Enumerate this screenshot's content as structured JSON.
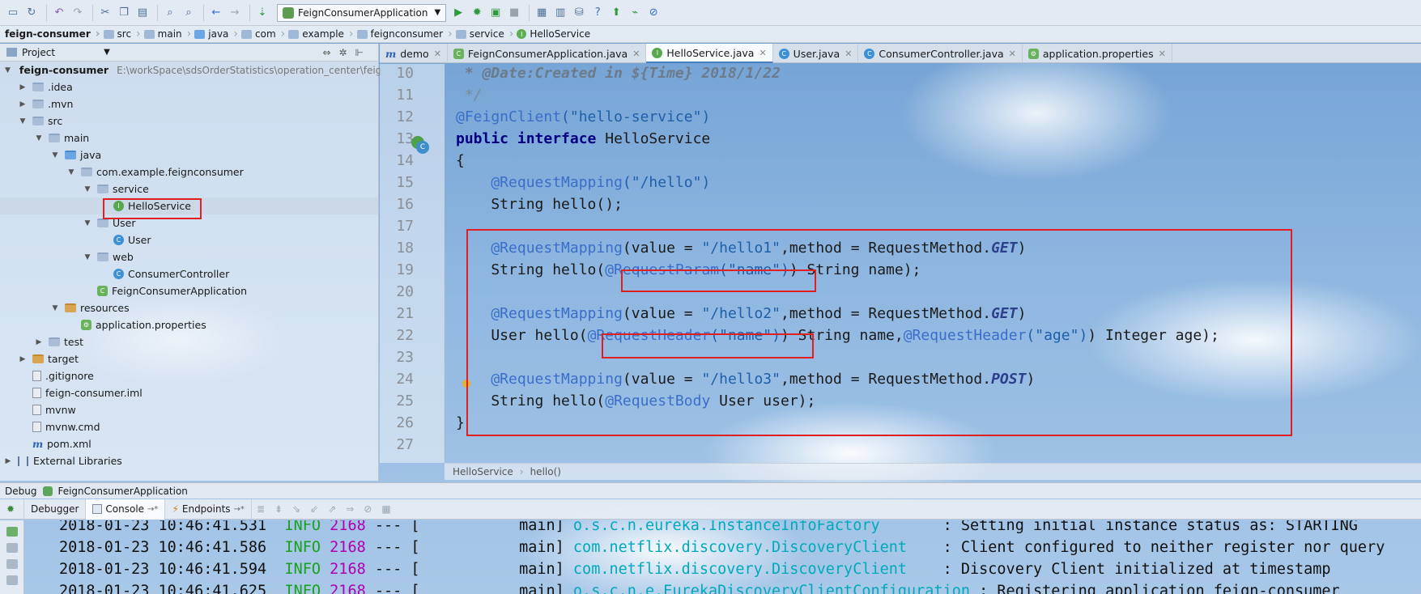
{
  "toolbar": {
    "run_config": "FeignConsumerApplication",
    "icons": [
      "save-icon",
      "sync-icon",
      "undo-icon",
      "redo-icon",
      "cut-icon",
      "copy-icon",
      "paste-icon",
      "find-icon",
      "replace-icon",
      "back-icon",
      "forward-icon",
      "build-icon",
      "run-icon",
      "debug-icon",
      "coverage-icon",
      "stop-icon",
      "project-structure-icon",
      "sdk-icon",
      "vcs-icon",
      "help-icon",
      "update-icon",
      "profile-icon",
      "close-icon"
    ]
  },
  "navbar": {
    "crumbs": [
      "feign-consumer",
      "src",
      "main",
      "java",
      "com",
      "example",
      "feignconsumer",
      "service",
      "HelloService"
    ]
  },
  "project_panel": {
    "title": "Project",
    "tree": [
      {
        "label": "feign-consumer",
        "path": "E:\\workSpace\\sdsOrderStatistics\\operation_center\\feig",
        "bold": true
      },
      {
        "label": ".idea"
      },
      {
        "label": ".mvn"
      },
      {
        "label": "src"
      },
      {
        "label": "main"
      },
      {
        "label": "java"
      },
      {
        "label": "com.example.feignconsumer"
      },
      {
        "label": "service"
      },
      {
        "label": "HelloService"
      },
      {
        "label": "User"
      },
      {
        "label": "User"
      },
      {
        "label": "web"
      },
      {
        "label": "ConsumerController"
      },
      {
        "label": "FeignConsumerApplication"
      },
      {
        "label": "resources"
      },
      {
        "label": "application.properties"
      },
      {
        "label": "test"
      },
      {
        "label": "target"
      },
      {
        "label": ".gitignore"
      },
      {
        "label": "feign-consumer.iml"
      },
      {
        "label": "mvnw"
      },
      {
        "label": "mvnw.cmd"
      },
      {
        "label": "pom.xml"
      },
      {
        "label": "External Libraries"
      }
    ]
  },
  "tabs": [
    "demo",
    "FeignConsumerApplication.java",
    "HelloService.java",
    "User.java",
    "ConsumerController.java",
    "application.properties"
  ],
  "editor": {
    "line_numbers": [
      "10",
      "11",
      "12",
      "13",
      "14",
      "15",
      "16",
      "17",
      "18",
      "19",
      "20",
      "21",
      "22",
      "23",
      "24",
      "25",
      "26",
      "27"
    ],
    "comment_line": " * @Date:Created in ${Time} 2018/1/22",
    "comment_end": " */",
    "l12_annot": "@FeignClient",
    "l12_str": "(\"hello-service\")",
    "l13_kw": "public interface",
    "l13_rest": " HelloService",
    "l14": "{",
    "l15_annot": "    @RequestMapping",
    "l15_str": "(\"/hello\")",
    "l16": "    String hello();",
    "l18_annot": "    @RequestMapping",
    "l18_a": "(value = ",
    "l18_str": "\"/hello1\"",
    "l18_b": ",method = RequestMethod.",
    "l18_get": "GET",
    "l18_c": ")",
    "l19_a": "    String hello(",
    "l19_annot": "@RequestParam",
    "l19_str": "(\"name\")",
    "l19_b": ") String name);",
    "l21_annot": "    @RequestMapping",
    "l21_a": "(value = ",
    "l21_str": "\"/hello2\"",
    "l21_b": ",method = RequestMethod.",
    "l21_get": "GET",
    "l21_c": ")",
    "l22_a": "    User hello(",
    "l22_annot1": "@RequestHeader",
    "l22_str1": "(\"name\")",
    "l22_b": ") String name,",
    "l22_annot2": "@RequestHeader",
    "l22_str2": "(\"age\")",
    "l22_c": ") Integer age);",
    "l24_annot": "    @RequestMapping",
    "l24_a": "(value = ",
    "l24_str": "\"/hello3\"",
    "l24_b": ",method = RequestMethod.",
    "l24_post": "POST",
    "l24_c": ")",
    "l25_a": "    String hello(",
    "l25_annot": "@RequestBody",
    "l25_b": " User user);",
    "l26": "}",
    "breadcrumb": [
      "HelloService",
      "hello()"
    ]
  },
  "debug": {
    "title": "Debug",
    "config": "FeignConsumerApplication",
    "tabs": [
      "Debugger",
      "Console",
      "Endpoints"
    ],
    "log": [
      {
        "ts": "2018-01-23 10:46:41.531",
        "level": "INFO",
        "pid": "2168",
        "sep": " --- [           main] ",
        "logger": "o.s.c.n.eureka.InstanceInfoFactory      ",
        "msg": " : Setting initial instance status as: STARTING"
      },
      {
        "ts": "2018-01-23 10:46:41.586",
        "level": "INFO",
        "pid": "2168",
        "sep": " --- [           main] ",
        "logger": "com.netflix.discovery.DiscoveryClient   ",
        "msg": " : Client configured to neither register nor query"
      },
      {
        "ts": "2018-01-23 10:46:41.594",
        "level": "INFO",
        "pid": "2168",
        "sep": " --- [           main] ",
        "logger": "com.netflix.discovery.DiscoveryClient   ",
        "msg": " : Discovery Client initialized at timestamp"
      },
      {
        "ts": "2018-01-23 10:46:41.625",
        "level": "INFO",
        "pid": "2168",
        "sep": " --- [           main] ",
        "logger": "o.s.c.n.e.EurekaDiscoveryClientConfiguration",
        "msg": " : Registering application feign-consumer"
      }
    ]
  },
  "colors": {
    "highlight_box": "#e02020",
    "annotation": "#3a6ec9",
    "log_info": "#19a01e",
    "log_pid": "#b000b0",
    "log_logger": "#00a9bb"
  }
}
